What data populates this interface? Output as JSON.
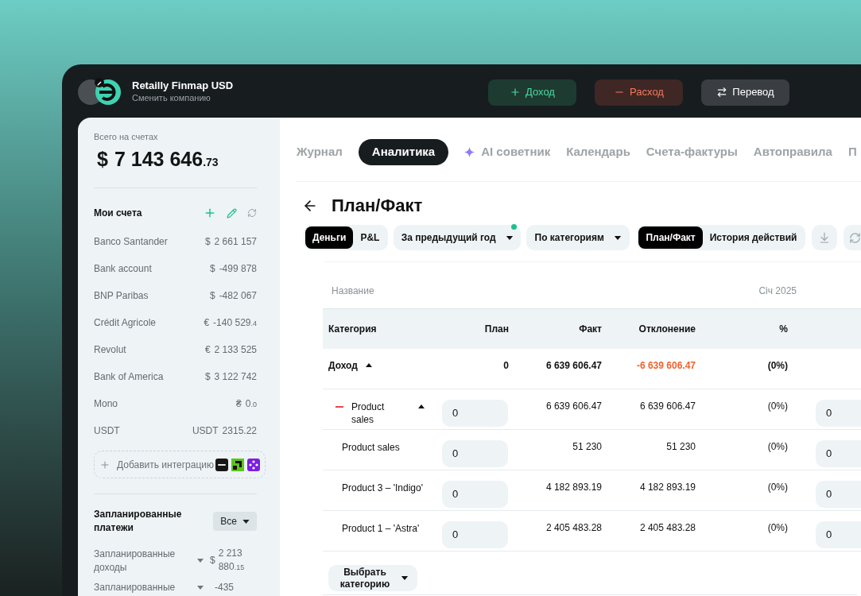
{
  "header": {
    "company": "Retailly Finmap USD",
    "switch_label": "Сменить компанию",
    "actions": [
      {
        "kind": "income",
        "label": "Доход"
      },
      {
        "kind": "expense",
        "label": "Расход"
      },
      {
        "kind": "transfer",
        "label": "Перевод"
      }
    ]
  },
  "sidebar": {
    "total_label": "Всего на счетах",
    "total": {
      "currency": "$",
      "amount": "7 143 646",
      "cents": ".73"
    },
    "accounts_title": "Мои счета",
    "accounts": [
      {
        "name": "Banco Santander",
        "currency": "$",
        "amount": "2 661 157"
      },
      {
        "name": "Bank account",
        "currency": "$",
        "amount": "-499 878"
      },
      {
        "name": "BNP Paribas",
        "currency": "$",
        "amount": "-482 067"
      },
      {
        "name": "Crédit Agricole",
        "currency": "€",
        "amount": "-140 529",
        "cents": ".4"
      },
      {
        "name": "Revolut",
        "currency": "€",
        "amount": "2 133 525"
      },
      {
        "name": "Bank of America",
        "currency": "$",
        "amount": "3 122 742"
      },
      {
        "name": "Mono",
        "currency": "₴",
        "amount": "0",
        "cents": ".0"
      },
      {
        "name": "USDT",
        "currency": "USDT",
        "amount": "2315.22"
      }
    ],
    "add_integration": "Добавить интеграцию",
    "scheduled_title": "Запланированные платежи",
    "scheduled_filter": "Все",
    "scheduled": [
      {
        "name": "Запланированные доходы",
        "currency": "$",
        "amount": "2 213 880",
        "cents": ".15"
      },
      {
        "name": "Запланированные",
        "amount": "-435"
      }
    ]
  },
  "tabs": [
    {
      "label": "Журнал",
      "selected": false
    },
    {
      "label": "Аналитика",
      "selected": true
    },
    {
      "label": "AI советник",
      "selected": false,
      "kind": "ai"
    },
    {
      "label": "Календарь",
      "selected": false
    },
    {
      "label": "Счета-фактуры",
      "selected": false
    },
    {
      "label": "Автоправила",
      "selected": false
    },
    {
      "label": "П",
      "selected": false
    }
  ],
  "page": {
    "title": "План/Факт"
  },
  "toolbar": {
    "mode": [
      {
        "label": "Деньги",
        "selected": true
      },
      {
        "label": "P&L",
        "selected": false
      }
    ],
    "period": {
      "label": "За предыдущий год",
      "badge": true
    },
    "grouping": "По категориям",
    "view": [
      {
        "label": "План/Факт",
        "selected": true
      },
      {
        "label": "История действий",
        "selected": false
      }
    ]
  },
  "table": {
    "name_label": "Название",
    "period_label": "Січ 2025",
    "columns": [
      "Категория",
      "План",
      "Факт",
      "Отклонение",
      "%"
    ],
    "rows": [
      {
        "kind": "total",
        "name": "Доход",
        "expanded": true,
        "plan": "0",
        "fact": "6 639 606.47",
        "deviation": "-6 639 606.47",
        "deviation_alert": true,
        "percent": "(0%)"
      },
      {
        "kind": "group",
        "name": "Product sales",
        "expanded": true,
        "plan": "0",
        "fact": "6 639 606.47",
        "deviation": "6 639 606.47",
        "deviation_alert": false,
        "percent": "(0%)",
        "next_plan": "0"
      },
      {
        "kind": "item",
        "name": "Product sales",
        "plan": "0",
        "fact": "51 230",
        "deviation": "51 230",
        "deviation_alert": false,
        "percent": "(0%)",
        "next_plan": "0"
      },
      {
        "kind": "item",
        "name": "Product 3 – 'Indigo'",
        "plan": "0",
        "fact": "4 182 893.19",
        "deviation": "4 182 893.19",
        "deviation_alert": false,
        "percent": "(0%)",
        "next_plan": "0"
      },
      {
        "kind": "item",
        "name": "Product 1 – 'Astra'",
        "plan": "0",
        "fact": "2 405 483.28",
        "deviation": "2 405 483.28",
        "deviation_alert": false,
        "percent": "(0%)",
        "next_plan": "0"
      }
    ],
    "add_category": "Выбрать категорию"
  }
}
